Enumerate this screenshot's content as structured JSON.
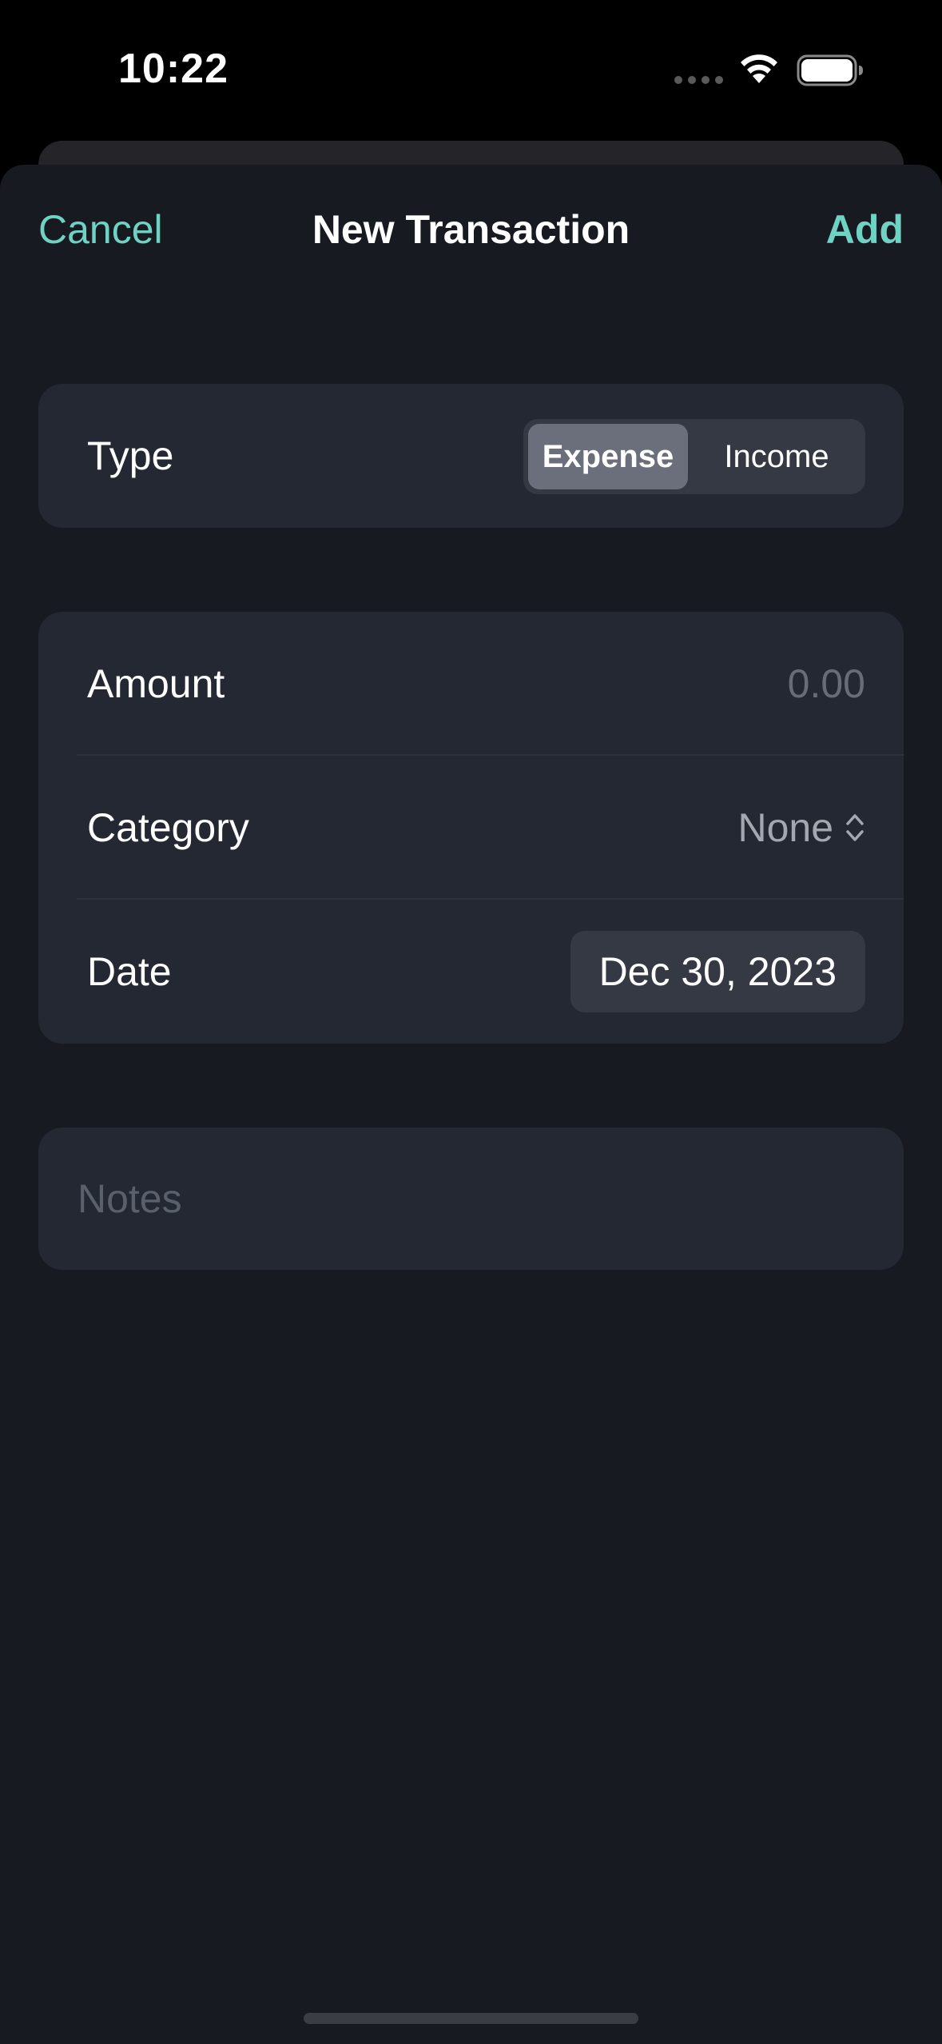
{
  "status_bar": {
    "time": "10:22"
  },
  "nav": {
    "cancel_label": "Cancel",
    "title": "New Transaction",
    "add_label": "Add",
    "accent_color": "#6fd3c4"
  },
  "type_section": {
    "label": "Type",
    "options": [
      "Expense",
      "Income"
    ],
    "selected": "Expense"
  },
  "details_section": {
    "amount": {
      "label": "Amount",
      "value": "",
      "placeholder": "0.00"
    },
    "category": {
      "label": "Category",
      "value": "None"
    },
    "date": {
      "label": "Date",
      "value": "Dec 30, 2023"
    }
  },
  "notes": {
    "value": "",
    "placeholder": "Notes"
  },
  "icons": {
    "wifi": "wifi-icon",
    "battery": "battery-icon",
    "category_chevron": "chevron-up-down-icon"
  }
}
